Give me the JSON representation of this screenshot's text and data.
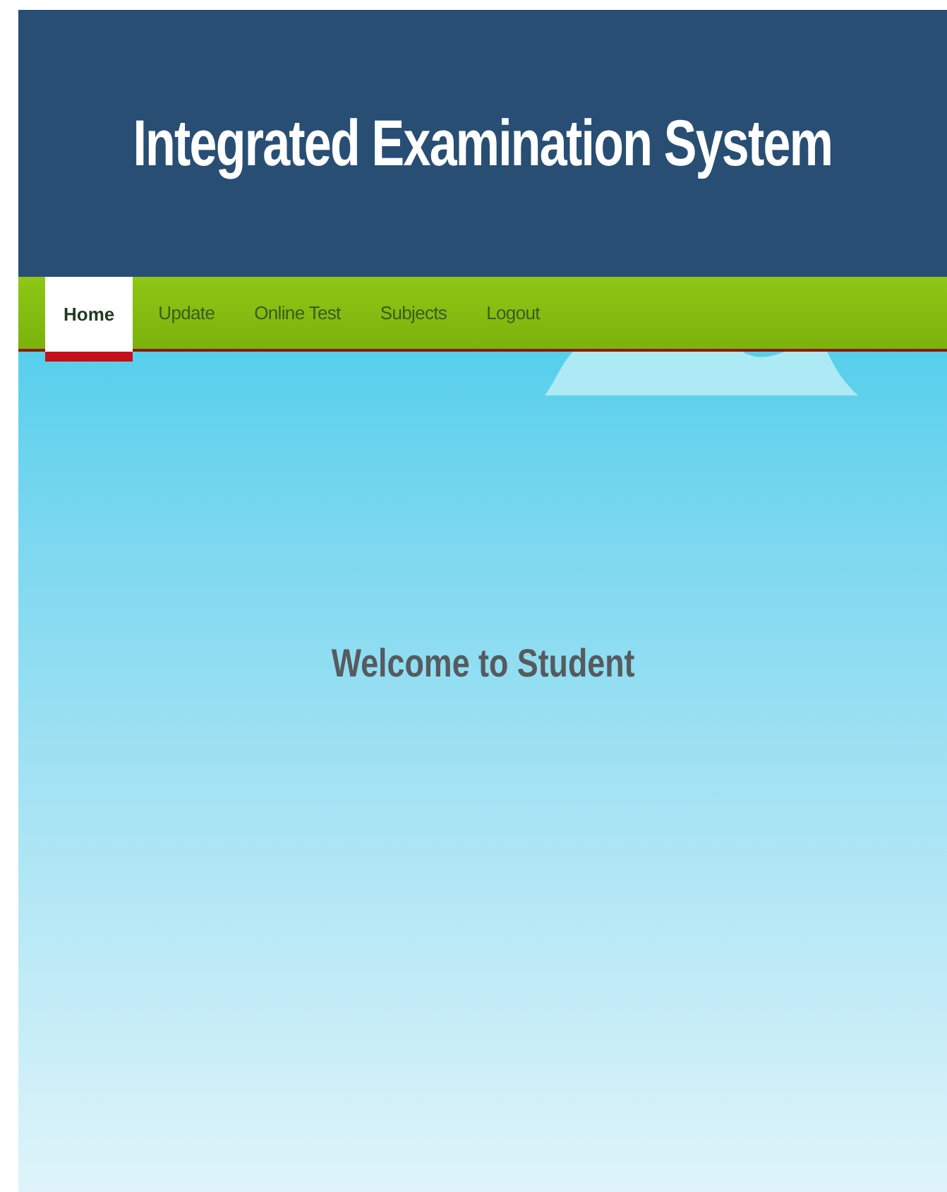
{
  "header": {
    "title": "Integrated Examination System"
  },
  "nav": [
    {
      "label": "Home",
      "selected": true
    },
    {
      "label": "Update",
      "selected": false
    },
    {
      "label": "Online Test",
      "selected": false
    },
    {
      "label": "Subjects",
      "selected": false
    },
    {
      "label": "Logout",
      "selected": false
    }
  ],
  "content": {
    "heading": "Welcome to Student"
  }
}
